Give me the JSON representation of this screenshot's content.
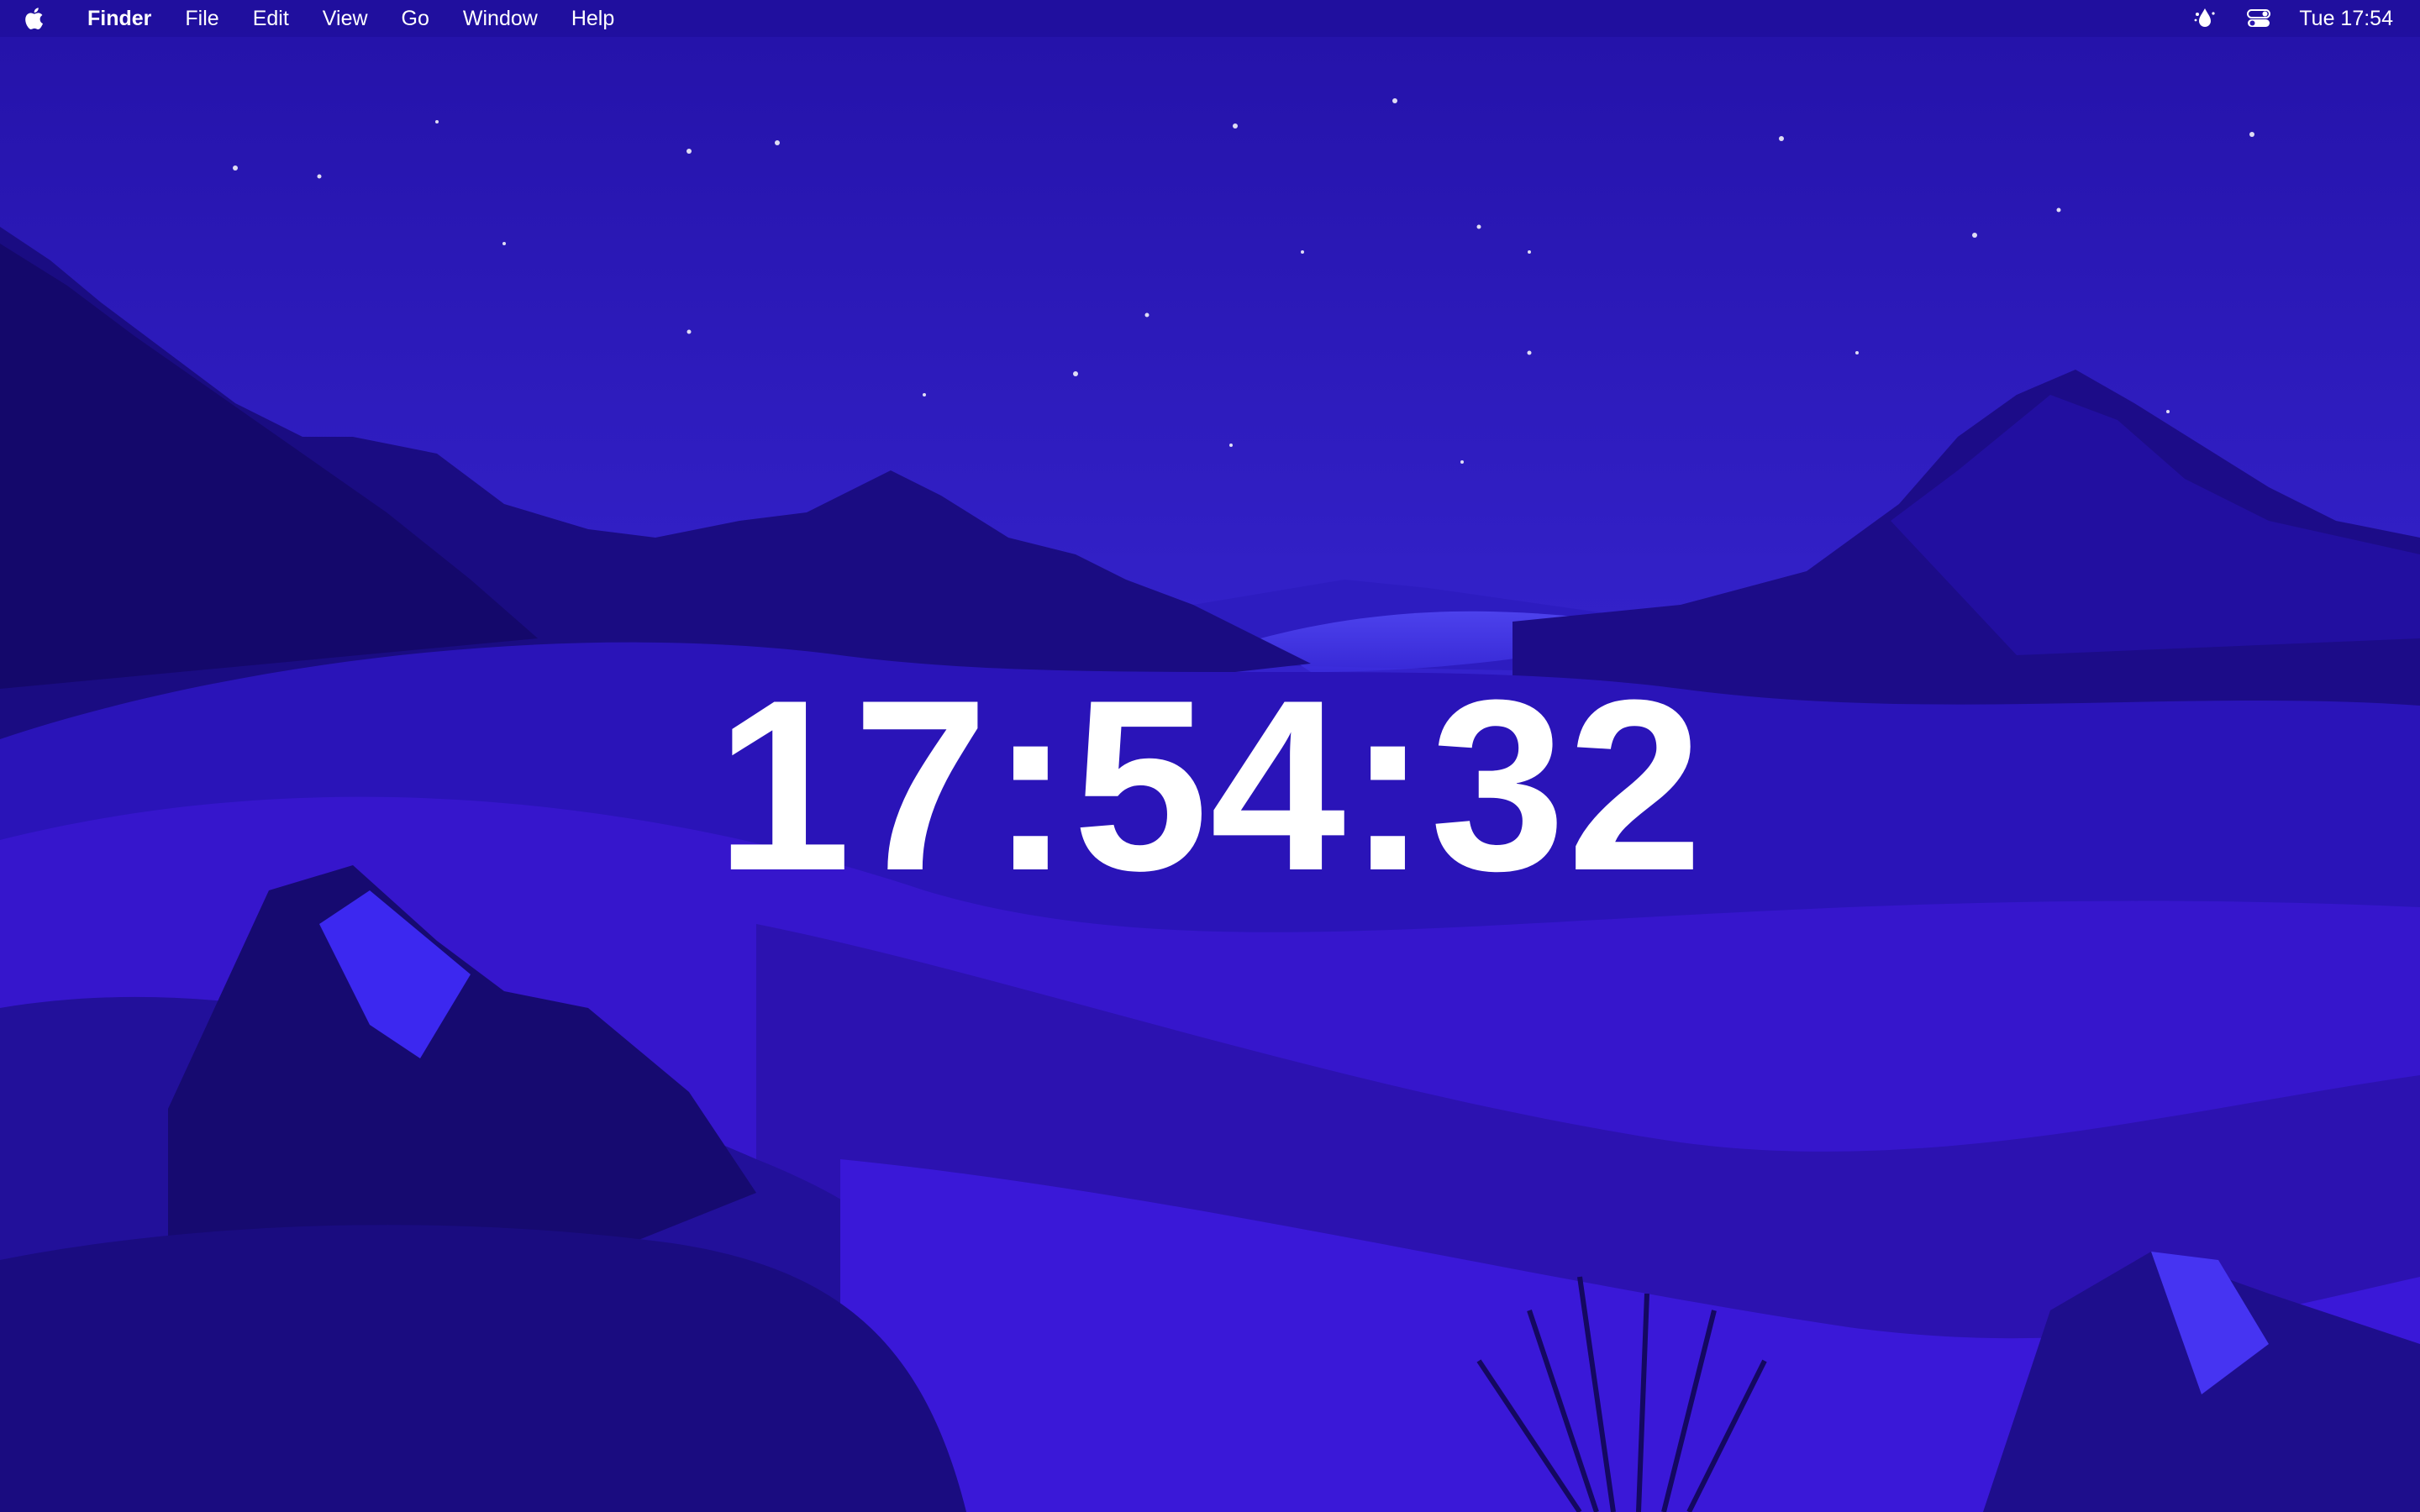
{
  "menubar": {
    "apple_icon": "apple-logo-icon",
    "app_name": "Finder",
    "menus": [
      "File",
      "Edit",
      "View",
      "Go",
      "Window",
      "Help"
    ],
    "status_icons": [
      "droplet-app-icon",
      "control-center-icon"
    ],
    "clock": "Tue 17:54"
  },
  "desktop": {
    "clock_widget": {
      "time": "17:54:32"
    }
  },
  "colors": {
    "sky_top": "#2a16b0",
    "sky_bottom": "#3b2be0",
    "mountain_dark": "#1a0a78",
    "dune_mid": "#3a1ad8",
    "dune_light": "#4a2ef0",
    "text": "#ffffff"
  }
}
